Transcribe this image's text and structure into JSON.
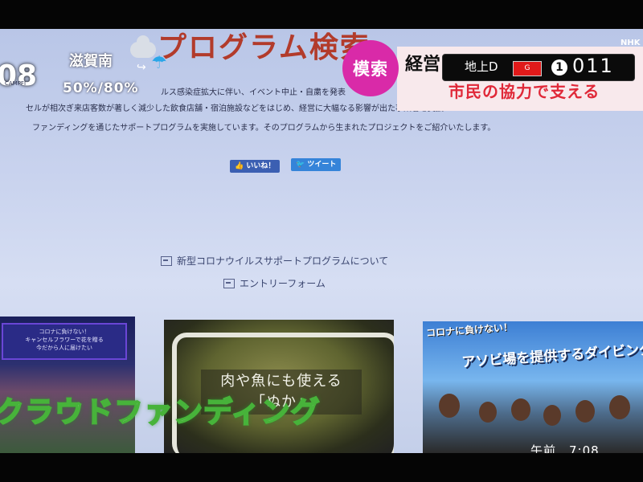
{
  "page": {
    "title": "プログラム検索",
    "camp_label": "CAMPFI",
    "body_lines": [
      "ルス感染症拡大に伴い、イベント中止・自粛を発表",
      "セルが相次ぎ来店客数が著しく減少した飲食店舗・宿泊施設などをはじめ、経営に大幅なる影響が出た事業者を支援",
      "ファンディングを通じたサポートプログラムを実施しています。そのプログラムから生まれたプロジェクトをご紹介いたします。"
    ],
    "like_button": "いいね！",
    "tweet_button": "ツイート",
    "links": [
      "新型コロナウイルスサポートプログラムについて",
      "エントリーフォーム"
    ],
    "cards": [
      {
        "box_text": [
          "コロナに負けない！",
          "キャンセルフラワーで花を贈る",
          "今だから人に届けたい"
        ]
      },
      {
        "caption_lines": [
          "肉や魚にも使える",
          "「ぬか」"
        ]
      },
      {
        "small_title": "コロナに負けない！",
        "big_title": "アソビ場を提供するダイビングショップ"
      }
    ]
  },
  "broadcast": {
    "clock": "08",
    "weather_region": "滋賀南",
    "precip": "50%/80%",
    "topic": "模索",
    "headline_top": "経営",
    "headline_sub": "市民の協力で支える",
    "network": "NHK",
    "channel_type": "地上D",
    "channel_g": "G",
    "channel_one": "1",
    "channel_number": "011",
    "overlay_caption": "クラウドファンディング",
    "time_label": "午前　7:08",
    "colors": {
      "topic": "#d92aa8",
      "headline_sub": "#e02838",
      "overlay_stroke": "#47b33a"
    }
  }
}
